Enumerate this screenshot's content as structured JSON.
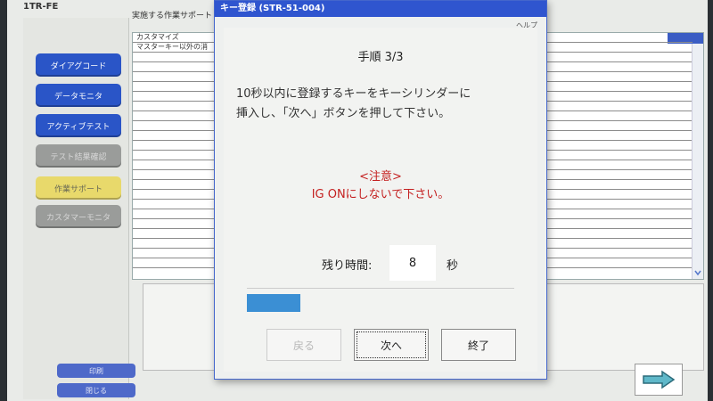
{
  "app": {
    "title": "1TR-FE"
  },
  "sidebar": {
    "items": [
      {
        "label": "ダイアグコード"
      },
      {
        "label": "データモニタ"
      },
      {
        "label": "アクティブテスト"
      },
      {
        "label": "テスト結果確認"
      },
      {
        "label": "作業サポート"
      },
      {
        "label": "カスタマーモニタ"
      }
    ],
    "bottom": [
      {
        "label": "印刷"
      },
      {
        "label": "閉じる"
      }
    ]
  },
  "main": {
    "label": "実施する作業サポート",
    "list": [
      "カスタマイズ",
      "マスターキー以外の消"
    ]
  },
  "dialog": {
    "title": "キー登録 (STR-51-004)",
    "help": "ヘルプ",
    "step": "手順 3/3",
    "instruction_line1": "10秒以内に登録するキーをキーシリンダーに",
    "instruction_line2": "挿入し、「次へ」ボタンを押して下さい。",
    "caution_title": "<注意>",
    "caution_text": "IG ONにしないで下さい。",
    "remaining_label": "残り時間:",
    "remaining_value": "8",
    "remaining_unit": "秒",
    "progress_fraction": 0.2,
    "buttons": {
      "back": "戻る",
      "next": "次へ",
      "finish": "終了"
    }
  },
  "colors": {
    "title_bar": "#2f55cf",
    "caution": "#c42020",
    "progress": "#3b8fd4"
  }
}
